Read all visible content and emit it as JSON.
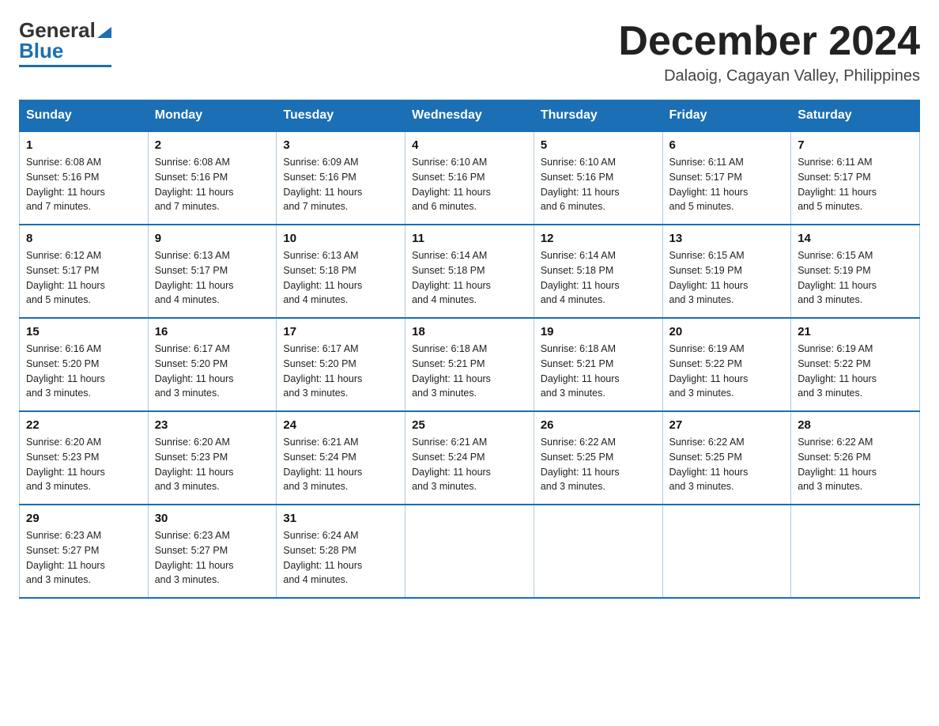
{
  "header": {
    "logo_general": "General",
    "logo_blue": "Blue",
    "month_title": "December 2024",
    "location": "Dalaoig, Cagayan Valley, Philippines"
  },
  "weekdays": [
    "Sunday",
    "Monday",
    "Tuesday",
    "Wednesday",
    "Thursday",
    "Friday",
    "Saturday"
  ],
  "weeks": [
    [
      {
        "day": "1",
        "sunrise": "6:08 AM",
        "sunset": "5:16 PM",
        "daylight": "11 hours and 7 minutes."
      },
      {
        "day": "2",
        "sunrise": "6:08 AM",
        "sunset": "5:16 PM",
        "daylight": "11 hours and 7 minutes."
      },
      {
        "day": "3",
        "sunrise": "6:09 AM",
        "sunset": "5:16 PM",
        "daylight": "11 hours and 7 minutes."
      },
      {
        "day": "4",
        "sunrise": "6:10 AM",
        "sunset": "5:16 PM",
        "daylight": "11 hours and 6 minutes."
      },
      {
        "day": "5",
        "sunrise": "6:10 AM",
        "sunset": "5:16 PM",
        "daylight": "11 hours and 6 minutes."
      },
      {
        "day": "6",
        "sunrise": "6:11 AM",
        "sunset": "5:17 PM",
        "daylight": "11 hours and 5 minutes."
      },
      {
        "day": "7",
        "sunrise": "6:11 AM",
        "sunset": "5:17 PM",
        "daylight": "11 hours and 5 minutes."
      }
    ],
    [
      {
        "day": "8",
        "sunrise": "6:12 AM",
        "sunset": "5:17 PM",
        "daylight": "11 hours and 5 minutes."
      },
      {
        "day": "9",
        "sunrise": "6:13 AM",
        "sunset": "5:17 PM",
        "daylight": "11 hours and 4 minutes."
      },
      {
        "day": "10",
        "sunrise": "6:13 AM",
        "sunset": "5:18 PM",
        "daylight": "11 hours and 4 minutes."
      },
      {
        "day": "11",
        "sunrise": "6:14 AM",
        "sunset": "5:18 PM",
        "daylight": "11 hours and 4 minutes."
      },
      {
        "day": "12",
        "sunrise": "6:14 AM",
        "sunset": "5:18 PM",
        "daylight": "11 hours and 4 minutes."
      },
      {
        "day": "13",
        "sunrise": "6:15 AM",
        "sunset": "5:19 PM",
        "daylight": "11 hours and 3 minutes."
      },
      {
        "day": "14",
        "sunrise": "6:15 AM",
        "sunset": "5:19 PM",
        "daylight": "11 hours and 3 minutes."
      }
    ],
    [
      {
        "day": "15",
        "sunrise": "6:16 AM",
        "sunset": "5:20 PM",
        "daylight": "11 hours and 3 minutes."
      },
      {
        "day": "16",
        "sunrise": "6:17 AM",
        "sunset": "5:20 PM",
        "daylight": "11 hours and 3 minutes."
      },
      {
        "day": "17",
        "sunrise": "6:17 AM",
        "sunset": "5:20 PM",
        "daylight": "11 hours and 3 minutes."
      },
      {
        "day": "18",
        "sunrise": "6:18 AM",
        "sunset": "5:21 PM",
        "daylight": "11 hours and 3 minutes."
      },
      {
        "day": "19",
        "sunrise": "6:18 AM",
        "sunset": "5:21 PM",
        "daylight": "11 hours and 3 minutes."
      },
      {
        "day": "20",
        "sunrise": "6:19 AM",
        "sunset": "5:22 PM",
        "daylight": "11 hours and 3 minutes."
      },
      {
        "day": "21",
        "sunrise": "6:19 AM",
        "sunset": "5:22 PM",
        "daylight": "11 hours and 3 minutes."
      }
    ],
    [
      {
        "day": "22",
        "sunrise": "6:20 AM",
        "sunset": "5:23 PM",
        "daylight": "11 hours and 3 minutes."
      },
      {
        "day": "23",
        "sunrise": "6:20 AM",
        "sunset": "5:23 PM",
        "daylight": "11 hours and 3 minutes."
      },
      {
        "day": "24",
        "sunrise": "6:21 AM",
        "sunset": "5:24 PM",
        "daylight": "11 hours and 3 minutes."
      },
      {
        "day": "25",
        "sunrise": "6:21 AM",
        "sunset": "5:24 PM",
        "daylight": "11 hours and 3 minutes."
      },
      {
        "day": "26",
        "sunrise": "6:22 AM",
        "sunset": "5:25 PM",
        "daylight": "11 hours and 3 minutes."
      },
      {
        "day": "27",
        "sunrise": "6:22 AM",
        "sunset": "5:25 PM",
        "daylight": "11 hours and 3 minutes."
      },
      {
        "day": "28",
        "sunrise": "6:22 AM",
        "sunset": "5:26 PM",
        "daylight": "11 hours and 3 minutes."
      }
    ],
    [
      {
        "day": "29",
        "sunrise": "6:23 AM",
        "sunset": "5:27 PM",
        "daylight": "11 hours and 3 minutes."
      },
      {
        "day": "30",
        "sunrise": "6:23 AM",
        "sunset": "5:27 PM",
        "daylight": "11 hours and 3 minutes."
      },
      {
        "day": "31",
        "sunrise": "6:24 AM",
        "sunset": "5:28 PM",
        "daylight": "11 hours and 4 minutes."
      },
      null,
      null,
      null,
      null
    ]
  ],
  "labels": {
    "sunrise": "Sunrise: ",
    "sunset": "Sunset: ",
    "daylight": "Daylight: "
  }
}
